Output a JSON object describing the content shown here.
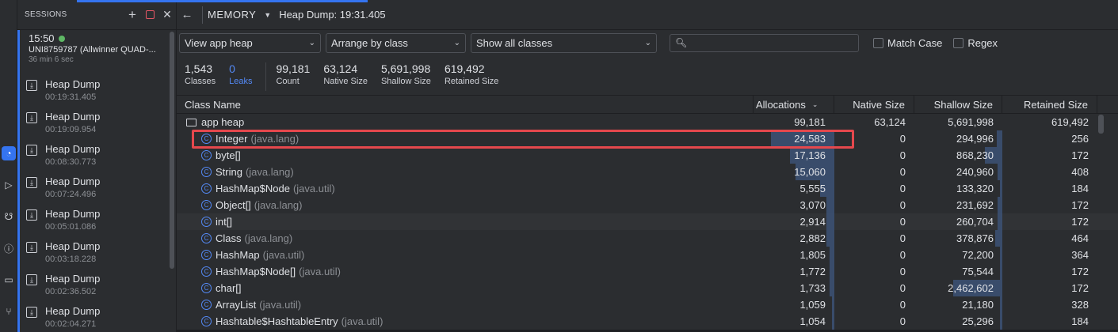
{
  "sessions": {
    "title": "SESSIONS",
    "current": {
      "time": "15:50",
      "device": "UNI8759787 (Allwinner QUAD-...",
      "duration": "36 min 6 sec"
    },
    "dumps": [
      {
        "name": "Heap Dump",
        "time": "00:19:31.405"
      },
      {
        "name": "Heap Dump",
        "time": "00:19:09.954"
      },
      {
        "name": "Heap Dump",
        "time": "00:08:30.773"
      },
      {
        "name": "Heap Dump",
        "time": "00:07:24.496"
      },
      {
        "name": "Heap Dump",
        "time": "00:05:01.086"
      },
      {
        "name": "Heap Dump",
        "time": "00:03:18.228"
      },
      {
        "name": "Heap Dump",
        "time": "00:02:36.502"
      },
      {
        "name": "Heap Dump",
        "time": "00:02:04.271"
      }
    ]
  },
  "toolbar": {
    "profiler": "MEMORY",
    "title": "Heap Dump: 19:31.405"
  },
  "filters": {
    "heap": "View app heap",
    "arrange": "Arrange by class",
    "show": "Show all classes",
    "search_placeholder": "",
    "match_case": "Match Case",
    "regex": "Regex"
  },
  "summary": [
    {
      "num": "1,543",
      "label": "Classes"
    },
    {
      "num": "0",
      "label": "Leaks"
    },
    {
      "num": "99,181",
      "label": "Count"
    },
    {
      "num": "63,124",
      "label": "Native Size"
    },
    {
      "num": "5,691,998",
      "label": "Shallow Size"
    },
    {
      "num": "619,492",
      "label": "Retained Size"
    }
  ],
  "table": {
    "headers": {
      "name": "Class Name",
      "alloc": "Allocations",
      "native": "Native Size",
      "shallow": "Shallow Size",
      "retained": "Retained Size"
    },
    "root": {
      "name": "app heap",
      "alloc": "99,181",
      "native": "63,124",
      "shallow": "5,691,998",
      "retained": "619,492"
    },
    "rows": [
      {
        "name": "Integer",
        "pkg": "(java.lang)",
        "alloc": "24,583",
        "native": "0",
        "shallow": "294,996",
        "retained": "256",
        "alloc_frac": 1.0,
        "shallow_frac": 0.12
      },
      {
        "name": "byte[]",
        "pkg": "",
        "alloc": "17,136",
        "native": "0",
        "shallow": "868,230",
        "retained": "172",
        "alloc_frac": 0.7,
        "shallow_frac": 0.35
      },
      {
        "name": "String",
        "pkg": "(java.lang)",
        "alloc": "15,060",
        "native": "0",
        "shallow": "240,960",
        "retained": "408",
        "alloc_frac": 0.61,
        "shallow_frac": 0.1
      },
      {
        "name": "HashMap$Node",
        "pkg": "(java.util)",
        "alloc": "5,555",
        "native": "0",
        "shallow": "133,320",
        "retained": "184",
        "alloc_frac": 0.23,
        "shallow_frac": 0.05
      },
      {
        "name": "Object[]",
        "pkg": "(java.lang)",
        "alloc": "3,070",
        "native": "0",
        "shallow": "231,692",
        "retained": "172",
        "alloc_frac": 0.12,
        "shallow_frac": 0.09
      },
      {
        "name": "int[]",
        "pkg": "",
        "alloc": "2,914",
        "native": "0",
        "shallow": "260,704",
        "retained": "172",
        "alloc_frac": 0.12,
        "shallow_frac": 0.1
      },
      {
        "name": "Class",
        "pkg": "(java.lang)",
        "alloc": "2,882",
        "native": "0",
        "shallow": "378,876",
        "retained": "464",
        "alloc_frac": 0.12,
        "shallow_frac": 0.15
      },
      {
        "name": "HashMap",
        "pkg": "(java.util)",
        "alloc": "1,805",
        "native": "0",
        "shallow": "72,200",
        "retained": "364",
        "alloc_frac": 0.07,
        "shallow_frac": 0.03
      },
      {
        "name": "HashMap$Node[]",
        "pkg": "(java.util)",
        "alloc": "1,772",
        "native": "0",
        "shallow": "75,544",
        "retained": "172",
        "alloc_frac": 0.07,
        "shallow_frac": 0.03
      },
      {
        "name": "char[]",
        "pkg": "",
        "alloc": "1,733",
        "native": "0",
        "shallow": "2,462,602",
        "retained": "172",
        "alloc_frac": 0.07,
        "shallow_frac": 1.0
      },
      {
        "name": "ArrayList",
        "pkg": "(java.util)",
        "alloc": "1,059",
        "native": "0",
        "shallow": "21,180",
        "retained": "328",
        "alloc_frac": 0.04,
        "shallow_frac": 0.01
      },
      {
        "name": "Hashtable$HashtableEntry",
        "pkg": "(java.util)",
        "alloc": "1,054",
        "native": "0",
        "shallow": "25,296",
        "retained": "184",
        "alloc_frac": 0.04,
        "shallow_frac": 0.01
      }
    ]
  },
  "colors": {
    "accent": "#3574f0",
    "bar": "#3c5275",
    "highlight": "#e5484d",
    "live": "#5fb865"
  }
}
